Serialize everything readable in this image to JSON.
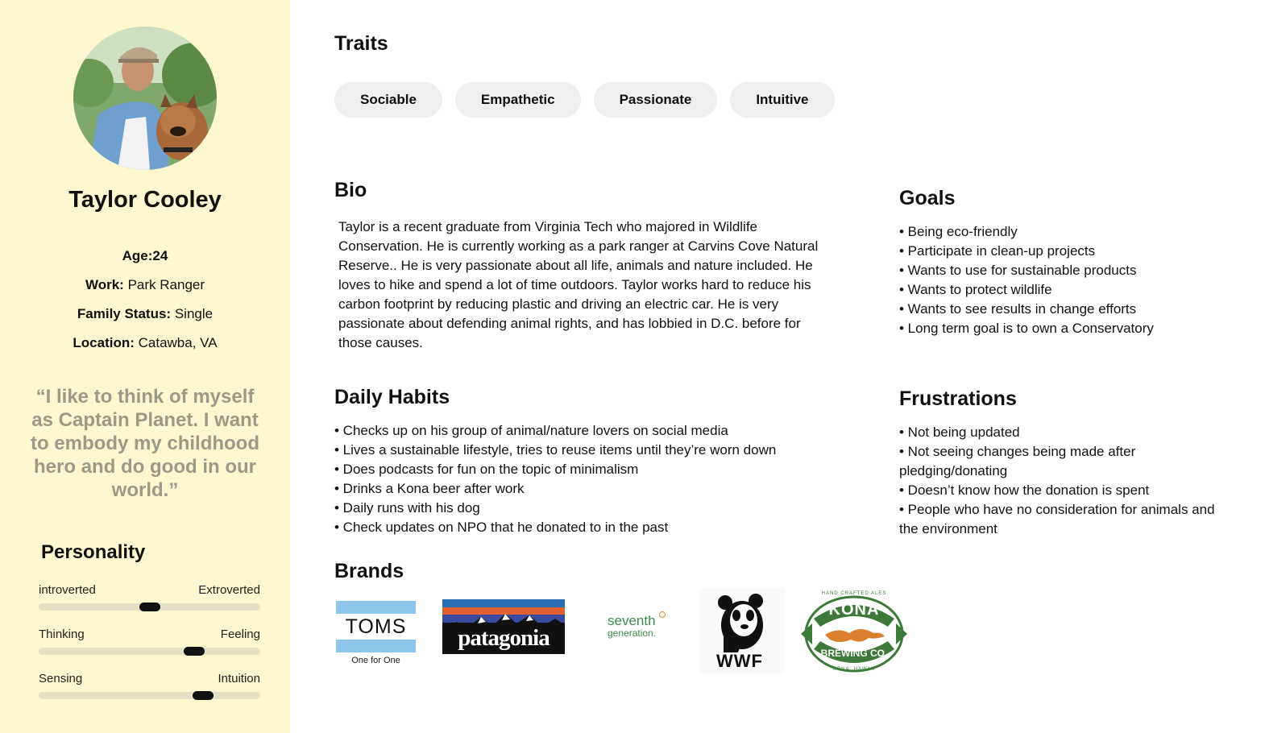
{
  "profile": {
    "name": "Taylor Cooley",
    "facts": [
      {
        "label": "Age:",
        "value": "24"
      },
      {
        "label": "Work:",
        "value": "Park Ranger"
      },
      {
        "label": "Family Status:",
        "value": "Single"
      },
      {
        "label": "Location:",
        "value": "Catawba, VA"
      }
    ],
    "quote": "“I like to think of myself as Captain Planet.  I want to embody my childhood hero and do good in our world.”"
  },
  "personality": {
    "title": "Personality",
    "sliders": [
      {
        "left": "introverted",
        "right": "Extroverted",
        "value": 0.5
      },
      {
        "left": "Thinking",
        "right": "Feeling",
        "value": 0.7
      },
      {
        "left": "Sensing",
        "right": "Intuition",
        "value": 0.74
      }
    ]
  },
  "traits": {
    "title": "Traits",
    "items": [
      "Sociable",
      "Empathetic",
      "Passionate",
      "Intuitive"
    ]
  },
  "bio": {
    "title": "Bio",
    "text": "Taylor is a recent graduate from Virginia Tech who majored in Wildlife Conservation. He is currently working as a park ranger at Carvins Cove Natural Reserve.. He is very passionate about all life, animals and nature included. He loves to hike and spend a lot of time outdoors. Taylor works hard to reduce his carbon footprint by reducing plastic and driving an electric car. He is very passionate about defending animal rights, and has lobbied in D.C. before for those causes."
  },
  "goals": {
    "title": "Goals",
    "items": [
      "• Being eco-friendly",
      "• Participate in clean-up projects",
      "• Wants to use for sustainable products",
      "• Wants to protect wildlife",
      "• Wants to see results in change efforts",
      "• Long term goal is to own a Conservatory"
    ]
  },
  "habits": {
    "title": "Daily Habits",
    "items": [
      "• Checks up on his group of animal/nature lovers on social media",
      "• Lives a sustainable lifestyle, tries to reuse items until they’re worn down",
      "• Does podcasts for fun on the topic of minimalism",
      "• Drinks a Kona beer after work",
      "• Daily runs with his dog",
      "• Check updates on NPO that he donated to in the past"
    ]
  },
  "frustrations": {
    "title": "Frustrations",
    "items": [
      "• Not being updated",
      "• Not seeing changes being made after pledging/donating",
      "• Doesn’t know how the donation is spent",
      "• People who have no consideration for animals and the environment"
    ]
  },
  "brands": {
    "title": "Brands",
    "toms": {
      "name": "TOMS",
      "tagline": "One for One"
    },
    "patagonia": {
      "name": "patagonia"
    },
    "seventh": {
      "line1": "seventh",
      "line2": "generation."
    },
    "wwf": {
      "name": "WWF"
    },
    "kona": {
      "top": "KONA",
      "bottom": "BREWING CO.",
      "arc_top": "HAND CRAFTED ALES",
      "arc_bottom": "KONA, HAWAII"
    }
  },
  "colors": {
    "sidebar_bg": "#fdf7cf",
    "quote": "#9b9a88",
    "chip_bg": "#efefef",
    "toms_blue": "#8ec6ea",
    "kona_green": "#3d7a3a",
    "kona_orange": "#d9802e"
  }
}
